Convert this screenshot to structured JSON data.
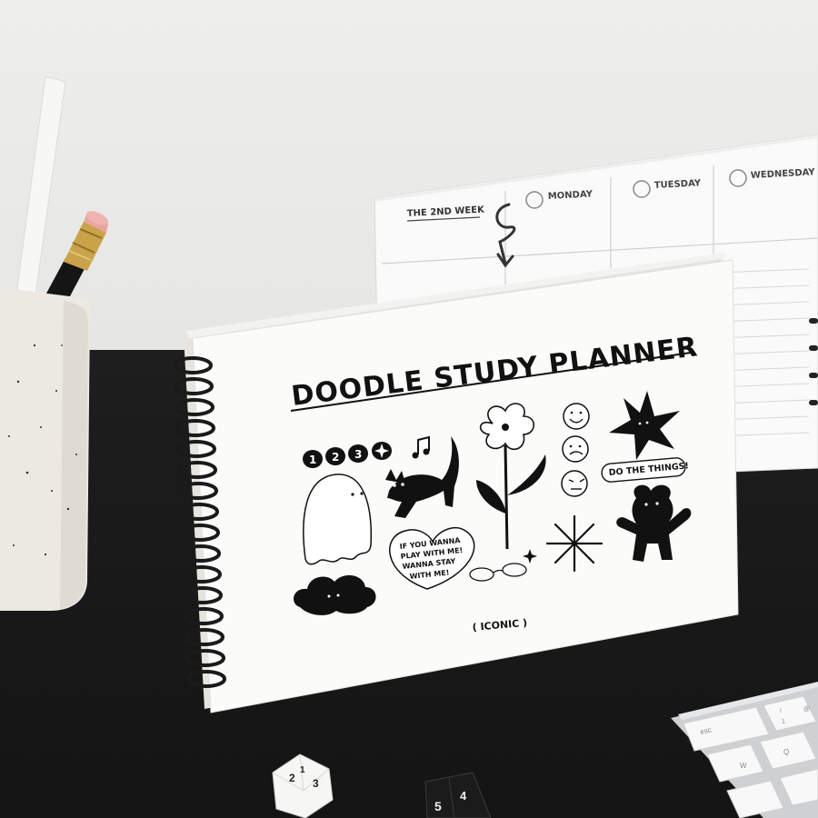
{
  "cover": {
    "title": "DOODLE STUDY PLANNER",
    "sticker_count": [
      "1",
      "2",
      "3"
    ],
    "bubble_lines": [
      "IF YOU WANNA",
      "PLAY WITH ME!",
      "WANNA STAY",
      "WITH ME!"
    ],
    "tag_label": "DO THE THINGS!",
    "brand": "( ICONIC )"
  },
  "back_page": {
    "week_label": "THE 2ND WEEK",
    "days": [
      "MONDAY",
      "TUESDAY",
      "WEDNESDAY"
    ]
  },
  "keyboard": {
    "keys": [
      "esc",
      "!",
      "1",
      "@",
      "Q",
      "W"
    ]
  },
  "dice": {
    "white_faces": [
      "2",
      "3",
      "1"
    ],
    "black_faces": [
      "5",
      "4"
    ]
  },
  "colors": {
    "desk": "#161616",
    "wall": "#ebebe9",
    "paper": "#fbfbfa",
    "ink": "#111111",
    "pencil_eraser": "#e9a3a0",
    "pencil_ferrule": "#c9a24a"
  }
}
